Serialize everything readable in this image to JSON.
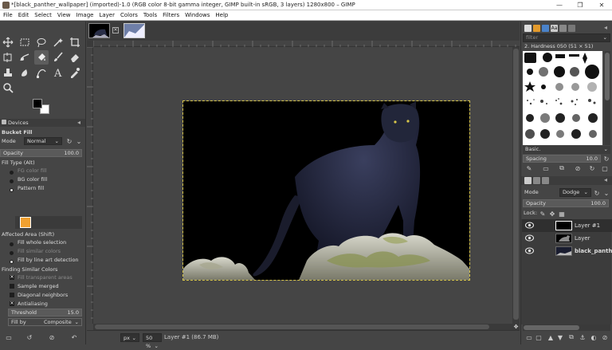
{
  "window": {
    "title": "*[black_panther_wallpaper] (imported)-1.0 (RGB color 8-bit gamma integer, GIMP built-in sRGB, 3 layers) 1280x800 – GIMP",
    "minimize": "—",
    "restore": "❐",
    "close": "✕"
  },
  "menu": [
    "File",
    "Edit",
    "Select",
    "View",
    "Image",
    "Layer",
    "Colors",
    "Tools",
    "Filters",
    "Windows",
    "Help"
  ],
  "tool_options": {
    "tabs": [
      "Devices",
      "▣",
      "▤"
    ],
    "tab_devices": "Devices",
    "title": "Bucket Fill",
    "mode_label": "Mode",
    "mode_value": "Normal",
    "opacity_label": "Opacity",
    "opacity_value": "100.0",
    "fill_type_label": "Fill Type  (Alt)",
    "fill_types": [
      "FG color fill",
      "BG color fill",
      "Pattern fill"
    ],
    "affected_label": "Affected Area  (Shift)",
    "affected": [
      "Fill whole selection",
      "Fill similar colors",
      "Fill by line art detection"
    ],
    "finding_label": "Finding Similar Colors",
    "finding_options": [
      "Fill transparent areas",
      "Sample merged",
      "Diagonal neighbors",
      "Antialiasing"
    ],
    "threshold_label": "Threshold",
    "threshold_value": "15.0",
    "fill_by_label": "Fill by",
    "fill_by_value": "Composite",
    "fg_color": "#000000",
    "bg_color": "#ffffff",
    "pattern_color": "#f0a030"
  },
  "status": {
    "unit": "px",
    "zoom": "50 %",
    "info": "Layer #1 (86.7 MB)"
  },
  "brushes": {
    "filter_placeholder": "filter",
    "current": "2. Hardness 050 (51 × 51)",
    "tag": "Basic.",
    "spacing_label": "Spacing",
    "spacing_value": "10.0"
  },
  "layers": {
    "mode_label": "Mode",
    "mode_value": "Dodge",
    "opacity_label": "Opacity",
    "opacity_value": "100.0",
    "lock_label": "Lock:",
    "items": [
      {
        "name": "Layer #1"
      },
      {
        "name": "Layer"
      },
      {
        "name": "black_panther"
      }
    ]
  }
}
